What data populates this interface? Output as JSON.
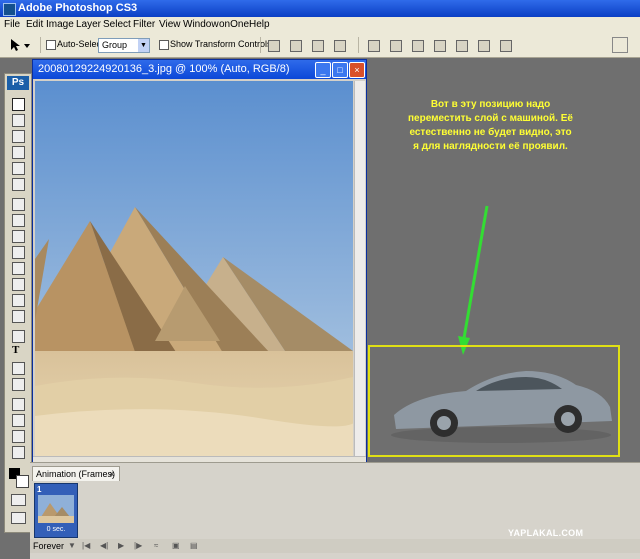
{
  "app": {
    "title": "Adobe Photoshop CS3"
  },
  "menu": [
    "File",
    "Edit",
    "Image",
    "Layer",
    "Select",
    "Filter",
    "View",
    "Window",
    "onOne",
    "Help"
  ],
  "options": {
    "auto_select_label": "Auto-Select:",
    "auto_select_value": "Group",
    "transform_label": "Show Transform Controls"
  },
  "toolbox": {
    "logo": "Ps",
    "type_tool": "T"
  },
  "document": {
    "title": "20080129224920136_3.jpg @ 100% (Auto, RGB/8)"
  },
  "annotation": "Вот в эту позицию надо переместить слой с машиной. Её естественно не будет видно, это я для наглядности её проявил.",
  "colors": {
    "annotation": "#ffff33",
    "arrow": "#33dd33",
    "selection": "#e0e014"
  },
  "animation": {
    "tab_label": "Animation (Frames)",
    "close": "×",
    "frame_number": "1",
    "frame_duration": "0 sec.",
    "loop": "Forever"
  },
  "watermark": "YAPLAKAL.COM"
}
